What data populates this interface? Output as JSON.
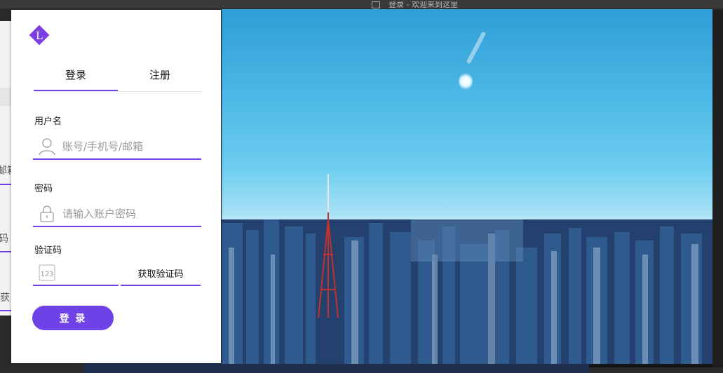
{
  "background_window": {
    "title_fragment": "登录 - 欢迎来到这里"
  },
  "background_fragments": [
    "邮箱",
    "码",
    "获"
  ],
  "logo": {
    "letter": "L"
  },
  "tabs": [
    {
      "label": "登录"
    },
    {
      "label": "注册"
    }
  ],
  "active_tab": "登录",
  "username": {
    "label": "用户名",
    "placeholder": "账号/手机号/邮箱",
    "value": ""
  },
  "password": {
    "label": "密码",
    "placeholder": "请输入账户密码",
    "value": ""
  },
  "captcha": {
    "label": "验证码",
    "placeholder": "",
    "value": "",
    "button_label": "获取验证码"
  },
  "login_button": {
    "label": "登 录"
  },
  "colors": {
    "accent": "#6f42e8",
    "card": "#ffffff",
    "text": "#111111",
    "placeholder": "#9a9a9a"
  },
  "icons": [
    "logo-diamond-icon",
    "user-icon",
    "lock-icon",
    "number-123-icon"
  ]
}
